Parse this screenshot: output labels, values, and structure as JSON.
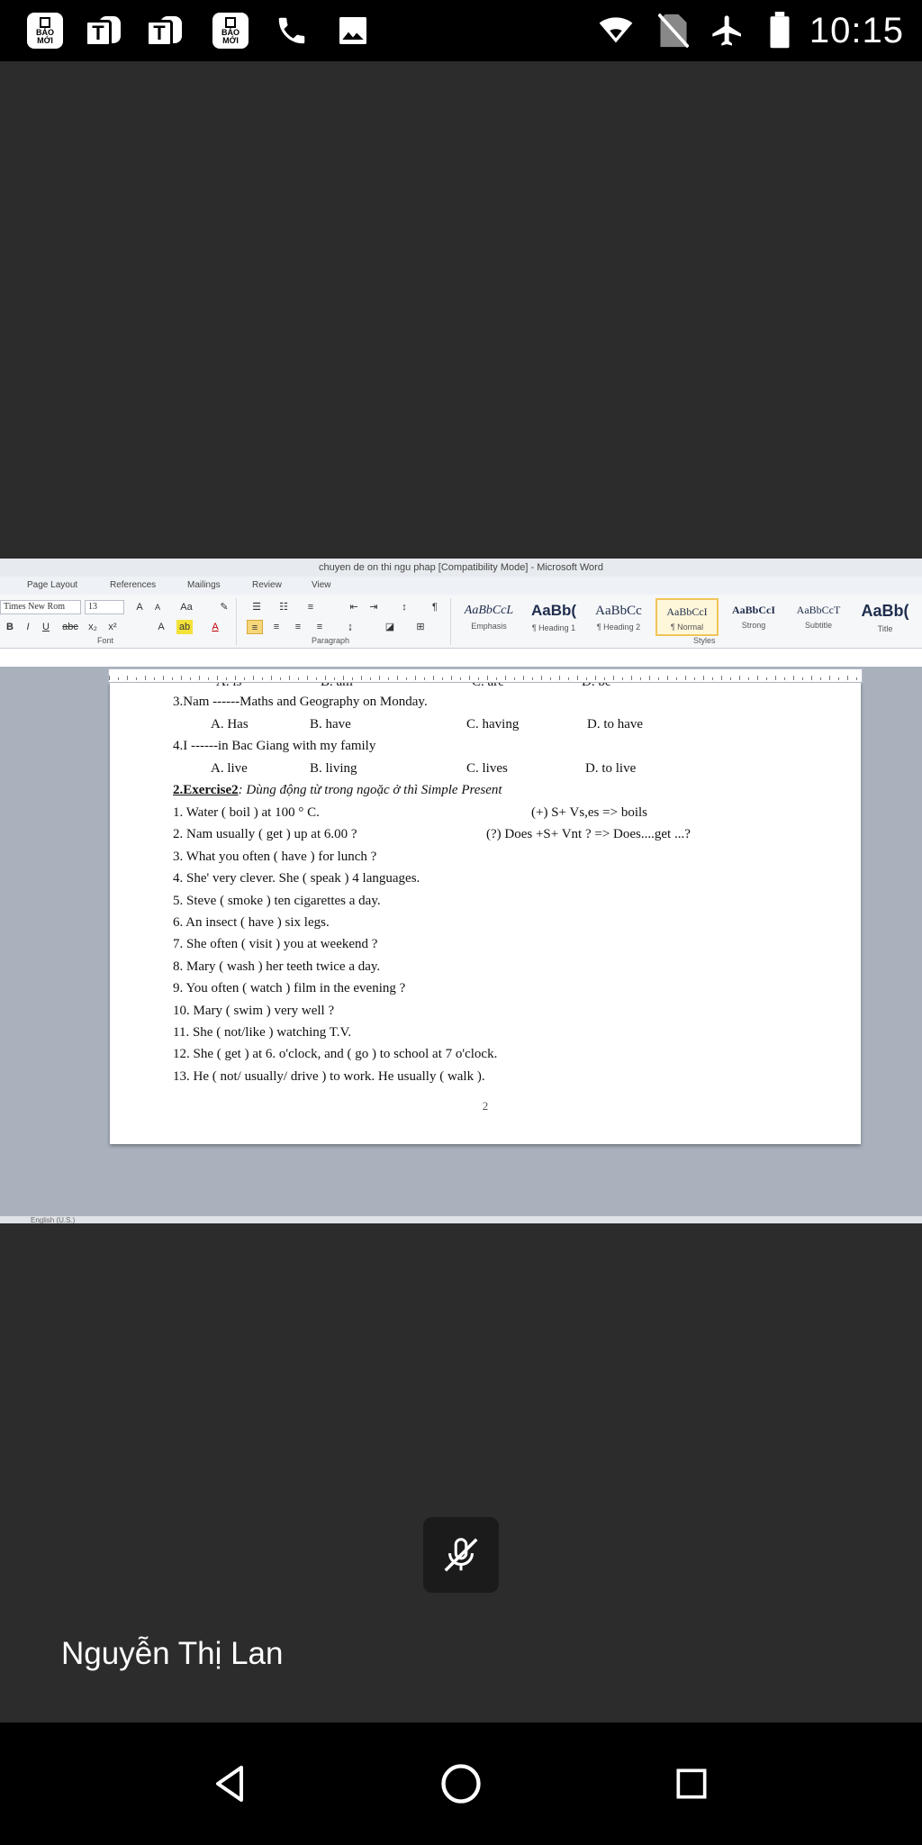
{
  "status_bar": {
    "time": "10:15",
    "notification_icons": [
      "bao-may-icon",
      "teams-icon",
      "teams-icon",
      "bao-may-icon",
      "phone-icon",
      "image-icon"
    ],
    "bao_may_label": "BÁO MỚI",
    "teams_letter": "T",
    "system_icons": [
      "wifi-icon",
      "no-sim-icon",
      "airplane-icon",
      "battery-icon"
    ]
  },
  "word": {
    "title": "chuyen de on thi ngu phap [Compatibility Mode] - Microsoft Word",
    "tabs": [
      "Page Layout",
      "References",
      "Mailings",
      "Review",
      "View"
    ],
    "font_name": "Times New Rom",
    "font_size": "13",
    "group_labels": {
      "font": "Font",
      "paragraph": "Paragraph",
      "styles": "Styles"
    },
    "styles": [
      {
        "sample": "AaBbCcL",
        "name": "Emphasis"
      },
      {
        "sample": "AaBb(",
        "name": "¶ Heading 1"
      },
      {
        "sample": "AaBbCc",
        "name": "¶ Heading 2"
      },
      {
        "sample": "AaBbCcI",
        "name": "¶ Normal"
      },
      {
        "sample": "AaBbCcI",
        "name": "Strong"
      },
      {
        "sample": "AaBbCcT",
        "name": "Subtitle"
      },
      {
        "sample": "AaBb(",
        "name": "Title"
      }
    ],
    "status_text": "English (U.S.)",
    "page_number": "2"
  },
  "document": {
    "cut_line": {
      "a": "A. is",
      "b": "B. am",
      "c": "C. are",
      "d": "D. be"
    },
    "q3": {
      "text": "3.Nam  ------Maths and Geography on Monday.",
      "a": "A. Has",
      "b": "B. have",
      "c": "C. having",
      "d": "D. to have"
    },
    "q4": {
      "text": "4.I ------in  Bac Giang with my family",
      "a": "A. live",
      "b": "B. living",
      "c": "C. lives",
      "d": "D. to live"
    },
    "exercise_title": "2.Exercise2",
    "exercise_subtitle": ": Dùng động từ trong ngoặc ở thì Simple Present",
    "items": [
      "1. Water ( boil ) at 100 ° C.",
      "2. Nam usually ( get ) up at 6.00 ?",
      "3. What you often ( have ) for lunch ?",
      "4. She' very clever. She ( speak ) 4 languages.",
      "5. Steve ( smoke ) ten cigarettes a day.",
      "6. An insect ( have ) six legs.",
      "7. She often ( visit ) you at weekend ?",
      "8. Mary ( wash ) her teeth twice a day.",
      "9. You often ( watch ) film in the evening ?",
      "10. Mary ( swim ) very well ?",
      "11. She ( not/like ) watching T.V.",
      "12. She ( get ) at 6. o'clock, and ( go ) to school at 7 o'clock.",
      "13. He ( not/ usually/ drive ) to work. He usually ( walk )."
    ],
    "note_1": "(+) S+ Vs,es   => boils",
    "note_2": "(?) Does  +S+  Vnt   ? => Does....get  ...?"
  },
  "meeting": {
    "participant_name": "Nguyễn Thị Lan",
    "mic_state": "muted"
  },
  "nav": [
    "back-icon",
    "home-icon",
    "recents-icon"
  ]
}
